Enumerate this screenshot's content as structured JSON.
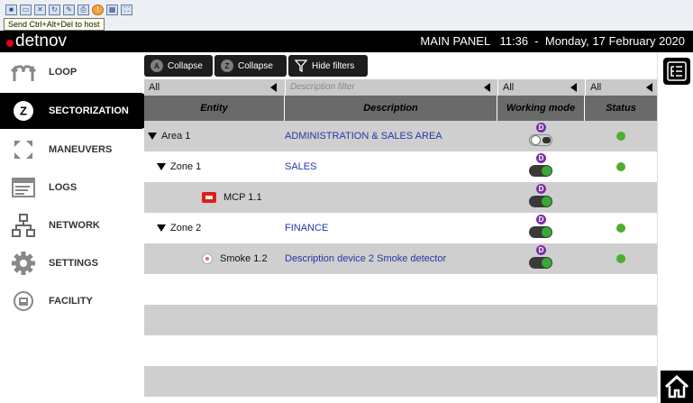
{
  "remote": {
    "tooltip": "Send Ctrl+Alt+Del to host",
    "icons": [
      "ctrl-alt-del-icon",
      "window-icon",
      "tools-icon",
      "refresh-icon",
      "paint-icon",
      "printer-icon",
      "warning-icon",
      "network-icon",
      "fullscreen-icon"
    ]
  },
  "header": {
    "logo": "detnov",
    "title": "MAIN PANEL   11:36  -  Monday, 17 February 2020",
    "brand_color": "#e3001b"
  },
  "sidebar": {
    "items": [
      {
        "label": "LOOP",
        "icon": "loop-icon"
      },
      {
        "label": "SECTORIZATION",
        "icon": "location-pin-icon"
      },
      {
        "label": "MANEUVERS",
        "icon": "maneuvers-icon"
      },
      {
        "label": "LOGS",
        "icon": "logs-icon"
      },
      {
        "label": "NETWORK",
        "icon": "network-icon"
      },
      {
        "label": "SETTINGS",
        "icon": "gear-icon"
      },
      {
        "label": "FACILITY",
        "icon": "facility-icon"
      }
    ],
    "active": "SECTORIZATION"
  },
  "toolbar": {
    "collapse_area": "Collapse",
    "collapse_zone": "Collapse",
    "hide_filters": "Hide filters",
    "area_badge": "A",
    "zone_badge": "Z"
  },
  "filters": {
    "entity": "All",
    "description_placeholder": "Description filter",
    "working_mode": "All",
    "status": "All"
  },
  "table": {
    "headers": [
      "Entity",
      "Description",
      "Working mode",
      "Status"
    ],
    "mode_badge": "D",
    "rows": [
      {
        "entity": "Area 1",
        "description": "ADMINISTRATION & SALES AREA",
        "toggle": "off",
        "status": "ok"
      },
      {
        "entity": "Zone 1",
        "description": "SALES",
        "toggle": "on",
        "status": "ok"
      },
      {
        "entity": "MCP 1.1",
        "description": "",
        "toggle": "on",
        "status": ""
      },
      {
        "entity": "Zone 2",
        "description": "FINANCE",
        "toggle": "on",
        "status": "ok"
      },
      {
        "entity": "Smoke 1.2",
        "description": "Description device 2 Smoke detector",
        "toggle": "on",
        "status": "ok"
      }
    ]
  },
  "colors": {
    "status_ok": "#4caf2e",
    "mode_badge": "#7a2fa5",
    "description_text": "#2538a6"
  }
}
